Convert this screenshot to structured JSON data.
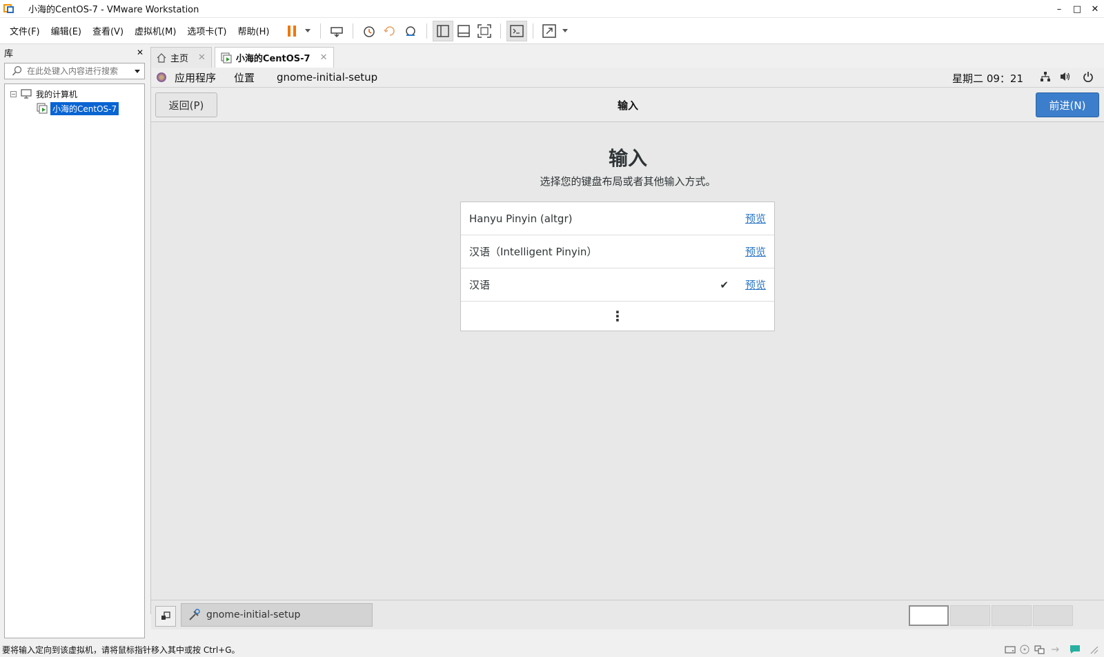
{
  "window": {
    "title": "小海的CentOS-7 - VMware Workstation",
    "controls": {
      "minimize": "–",
      "maximize": "□",
      "close": "✕"
    }
  },
  "menu": [
    "文件(F)",
    "编辑(E)",
    "查看(V)",
    "虚拟机(M)",
    "选项卡(T)",
    "帮助(H)"
  ],
  "library": {
    "title": "库",
    "close_glyph": "✕",
    "search_placeholder": "在此处键入内容进行搜索",
    "tree": {
      "root": "我的计算机",
      "vm": "小海的CentOS-7",
      "toggle": "⊟"
    }
  },
  "tabs": [
    {
      "label": "主页",
      "close": "✕"
    },
    {
      "label": "小海的CentOS-7",
      "close": "✕"
    }
  ],
  "gnome_top": {
    "applications": "应用程序",
    "places": "位置",
    "app_name": "gnome-initial-setup",
    "clock": "星期二 09：21"
  },
  "setup": {
    "back": "返回(P)",
    "header_title": "输入",
    "next": "前进(N)",
    "heading": "输入",
    "subtitle": "选择您的键盘布局或者其他输入方式。",
    "inputs": [
      {
        "name": "Hanyu Pinyin (altgr)",
        "preview": "预览",
        "selected": false
      },
      {
        "name": "汉语（Intelligent Pinyin）",
        "preview": "预览",
        "selected": false
      },
      {
        "name": "汉语",
        "preview": "预览",
        "selected": true
      }
    ],
    "check_glyph": "✔",
    "more_glyph": "⋮"
  },
  "gnome_bottom": {
    "task": "gnome-initial-setup",
    "workspaces": 4,
    "active_workspace": 1
  },
  "status": {
    "text": "要将输入定向到该虚拟机，请将鼠标指针移入其中或按 Ctrl+G。"
  },
  "colors": {
    "accent_blue": "#3c7ecb",
    "link": "#2a76c6",
    "selection": "#0a64d2",
    "pause_orange": "#f07800"
  }
}
